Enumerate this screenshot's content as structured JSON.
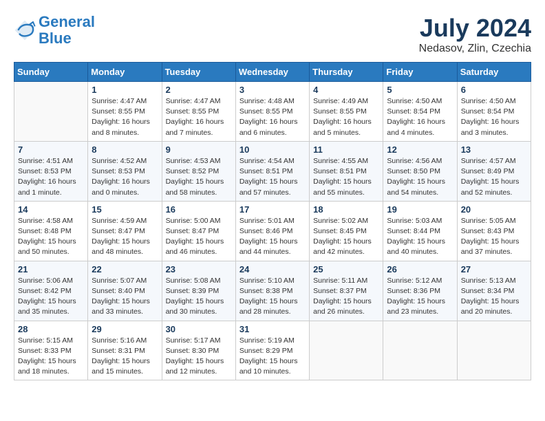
{
  "header": {
    "logo_line1": "General",
    "logo_line2": "Blue",
    "month": "July 2024",
    "location": "Nedasov, Zlin, Czechia"
  },
  "weekdays": [
    "Sunday",
    "Monday",
    "Tuesday",
    "Wednesday",
    "Thursday",
    "Friday",
    "Saturday"
  ],
  "weeks": [
    [
      {
        "day": "",
        "info": ""
      },
      {
        "day": "1",
        "info": "Sunrise: 4:47 AM\nSunset: 8:55 PM\nDaylight: 16 hours\nand 8 minutes."
      },
      {
        "day": "2",
        "info": "Sunrise: 4:47 AM\nSunset: 8:55 PM\nDaylight: 16 hours\nand 7 minutes."
      },
      {
        "day": "3",
        "info": "Sunrise: 4:48 AM\nSunset: 8:55 PM\nDaylight: 16 hours\nand 6 minutes."
      },
      {
        "day": "4",
        "info": "Sunrise: 4:49 AM\nSunset: 8:55 PM\nDaylight: 16 hours\nand 5 minutes."
      },
      {
        "day": "5",
        "info": "Sunrise: 4:50 AM\nSunset: 8:54 PM\nDaylight: 16 hours\nand 4 minutes."
      },
      {
        "day": "6",
        "info": "Sunrise: 4:50 AM\nSunset: 8:54 PM\nDaylight: 16 hours\nand 3 minutes."
      }
    ],
    [
      {
        "day": "7",
        "info": "Sunrise: 4:51 AM\nSunset: 8:53 PM\nDaylight: 16 hours\nand 1 minute."
      },
      {
        "day": "8",
        "info": "Sunrise: 4:52 AM\nSunset: 8:53 PM\nDaylight: 16 hours\nand 0 minutes."
      },
      {
        "day": "9",
        "info": "Sunrise: 4:53 AM\nSunset: 8:52 PM\nDaylight: 15 hours\nand 58 minutes."
      },
      {
        "day": "10",
        "info": "Sunrise: 4:54 AM\nSunset: 8:51 PM\nDaylight: 15 hours\nand 57 minutes."
      },
      {
        "day": "11",
        "info": "Sunrise: 4:55 AM\nSunset: 8:51 PM\nDaylight: 15 hours\nand 55 minutes."
      },
      {
        "day": "12",
        "info": "Sunrise: 4:56 AM\nSunset: 8:50 PM\nDaylight: 15 hours\nand 54 minutes."
      },
      {
        "day": "13",
        "info": "Sunrise: 4:57 AM\nSunset: 8:49 PM\nDaylight: 15 hours\nand 52 minutes."
      }
    ],
    [
      {
        "day": "14",
        "info": "Sunrise: 4:58 AM\nSunset: 8:48 PM\nDaylight: 15 hours\nand 50 minutes."
      },
      {
        "day": "15",
        "info": "Sunrise: 4:59 AM\nSunset: 8:47 PM\nDaylight: 15 hours\nand 48 minutes."
      },
      {
        "day": "16",
        "info": "Sunrise: 5:00 AM\nSunset: 8:47 PM\nDaylight: 15 hours\nand 46 minutes."
      },
      {
        "day": "17",
        "info": "Sunrise: 5:01 AM\nSunset: 8:46 PM\nDaylight: 15 hours\nand 44 minutes."
      },
      {
        "day": "18",
        "info": "Sunrise: 5:02 AM\nSunset: 8:45 PM\nDaylight: 15 hours\nand 42 minutes."
      },
      {
        "day": "19",
        "info": "Sunrise: 5:03 AM\nSunset: 8:44 PM\nDaylight: 15 hours\nand 40 minutes."
      },
      {
        "day": "20",
        "info": "Sunrise: 5:05 AM\nSunset: 8:43 PM\nDaylight: 15 hours\nand 37 minutes."
      }
    ],
    [
      {
        "day": "21",
        "info": "Sunrise: 5:06 AM\nSunset: 8:42 PM\nDaylight: 15 hours\nand 35 minutes."
      },
      {
        "day": "22",
        "info": "Sunrise: 5:07 AM\nSunset: 8:40 PM\nDaylight: 15 hours\nand 33 minutes."
      },
      {
        "day": "23",
        "info": "Sunrise: 5:08 AM\nSunset: 8:39 PM\nDaylight: 15 hours\nand 30 minutes."
      },
      {
        "day": "24",
        "info": "Sunrise: 5:10 AM\nSunset: 8:38 PM\nDaylight: 15 hours\nand 28 minutes."
      },
      {
        "day": "25",
        "info": "Sunrise: 5:11 AM\nSunset: 8:37 PM\nDaylight: 15 hours\nand 26 minutes."
      },
      {
        "day": "26",
        "info": "Sunrise: 5:12 AM\nSunset: 8:36 PM\nDaylight: 15 hours\nand 23 minutes."
      },
      {
        "day": "27",
        "info": "Sunrise: 5:13 AM\nSunset: 8:34 PM\nDaylight: 15 hours\nand 20 minutes."
      }
    ],
    [
      {
        "day": "28",
        "info": "Sunrise: 5:15 AM\nSunset: 8:33 PM\nDaylight: 15 hours\nand 18 minutes."
      },
      {
        "day": "29",
        "info": "Sunrise: 5:16 AM\nSunset: 8:31 PM\nDaylight: 15 hours\nand 15 minutes."
      },
      {
        "day": "30",
        "info": "Sunrise: 5:17 AM\nSunset: 8:30 PM\nDaylight: 15 hours\nand 12 minutes."
      },
      {
        "day": "31",
        "info": "Sunrise: 5:19 AM\nSunset: 8:29 PM\nDaylight: 15 hours\nand 10 minutes."
      },
      {
        "day": "",
        "info": ""
      },
      {
        "day": "",
        "info": ""
      },
      {
        "day": "",
        "info": ""
      }
    ]
  ]
}
